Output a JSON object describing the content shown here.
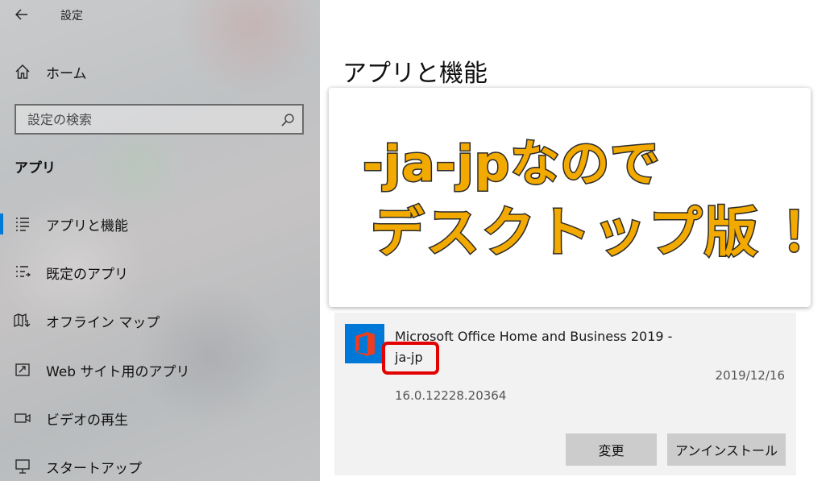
{
  "window": {
    "title": "設定"
  },
  "sidebar": {
    "home_label": "ホーム",
    "search_placeholder": "設定の検索",
    "section_title": "アプリ",
    "items": [
      {
        "label": "アプリと機能",
        "icon": "apps-features-icon",
        "active": true
      },
      {
        "label": "既定のアプリ",
        "icon": "default-apps-icon",
        "active": false
      },
      {
        "label": "オフライン マップ",
        "icon": "offline-maps-icon",
        "active": false
      },
      {
        "label": "Web サイト用のアプリ",
        "icon": "apps-for-websites-icon",
        "active": false
      },
      {
        "label": "ビデオの再生",
        "icon": "video-playback-icon",
        "active": false
      },
      {
        "label": "スタートアップ",
        "icon": "startup-icon",
        "active": false
      }
    ]
  },
  "main": {
    "page_title": "アプリと機能",
    "callout": {
      "line1": "-ja-jpなので",
      "line2": "デスクトップ版 ！",
      "text_color": "#f2a900",
      "outline_color": "#2a2a2a"
    },
    "app": {
      "name_line1": "Microsoft Office Home and Business 2019 -",
      "name_line2": "ja-jp",
      "date": "2019/12/16",
      "version": "16.0.12228.20364",
      "icon": "office-logo-icon",
      "icon_color": "#0078d7",
      "highlight_color": "#e30000"
    },
    "buttons": {
      "modify": "変更",
      "uninstall": "アンインストール"
    }
  },
  "colors": {
    "accent": "#0078d7"
  }
}
